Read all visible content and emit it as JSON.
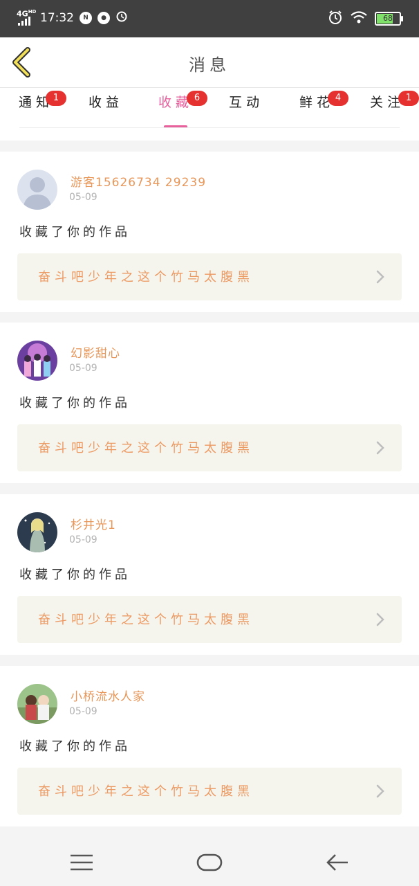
{
  "status": {
    "network": "4G",
    "network_sup": "HD",
    "time": "17:32",
    "icons_left": [
      "nfc-icon",
      "app-icon",
      "alarm-icon"
    ],
    "icons_right": [
      "alarm-icon",
      "wifi-icon",
      "battery-icon"
    ],
    "battery": "68"
  },
  "header": {
    "title": "消息",
    "back_icon": "chevron-left-icon"
  },
  "tabs": [
    {
      "label": "通知",
      "badge": "1"
    },
    {
      "label": "收益",
      "badge": ""
    },
    {
      "label": "收藏",
      "badge": "6",
      "active": true
    },
    {
      "label": "互动",
      "badge": ""
    },
    {
      "label": "鲜花",
      "badge": "4"
    },
    {
      "label": "关注",
      "badge": "1"
    }
  ],
  "notifications": [
    {
      "user": "游客15626734 29239",
      "date": "05-09",
      "action": "收藏了你的作品",
      "work": "奋斗吧少年之这个竹马太腹黑"
    },
    {
      "user": "幻影甜心",
      "date": "05-09",
      "action": "收藏了你的作品",
      "work": "奋斗吧少年之这个竹马太腹黑"
    },
    {
      "user": "杉井光1",
      "date": "05-09",
      "action": "收藏了你的作品",
      "work": "奋斗吧少年之这个竹马太腹黑"
    },
    {
      "user": "小桥流水人家",
      "date": "05-09",
      "action": "收藏了你的作品",
      "work": "奋斗吧少年之这个竹马太腹黑"
    }
  ],
  "navbar": {
    "icons": [
      "menu-icon",
      "home-icon",
      "back-arrow-icon"
    ]
  },
  "colors": {
    "accent": "#e8619d",
    "badge": "#e5312f",
    "username": "#e8975a",
    "work_title": "#ec9a63"
  }
}
